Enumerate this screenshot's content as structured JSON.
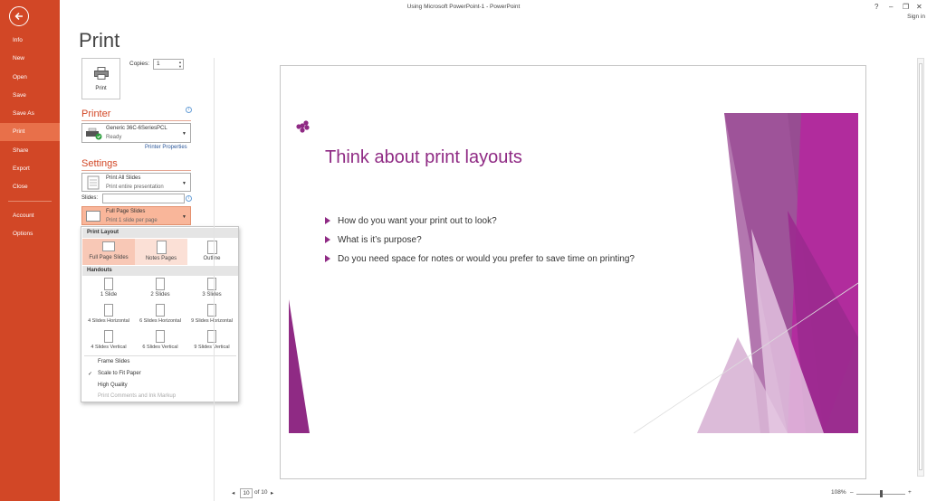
{
  "window": {
    "title": "Using Microsoft PowerPoint-1 - PowerPoint",
    "help": "?",
    "minimize": "–",
    "restore": "❐",
    "close": "✕",
    "sign_in": "Sign in"
  },
  "nav": {
    "items": [
      {
        "label": "Info"
      },
      {
        "label": "New"
      },
      {
        "label": "Open"
      },
      {
        "label": "Save"
      },
      {
        "label": "Save As"
      },
      {
        "label": "Print"
      },
      {
        "label": "Share"
      },
      {
        "label": "Export"
      },
      {
        "label": "Close"
      },
      {
        "label": "Account"
      },
      {
        "label": "Options"
      }
    ],
    "active": "Print"
  },
  "page_title": "Print",
  "print_button": {
    "label": "Print"
  },
  "copies": {
    "label": "Copies:",
    "value": "1"
  },
  "printer": {
    "heading": "Printer",
    "name": "Generic 36C-6SeriesPCL",
    "status": "Ready",
    "properties_link": "Printer Properties"
  },
  "settings": {
    "heading": "Settings",
    "range": {
      "title": "Print All Slides",
      "subtitle": "Print entire presentation"
    },
    "slides_label": "Slides:",
    "slides_value": "",
    "layout": {
      "title": "Full Page Slides",
      "subtitle": "Print 1 slide per page"
    }
  },
  "layout_popup": {
    "print_layout_header": "Print Layout",
    "print_layout": [
      {
        "label": "Full Page Slides",
        "state": "selected"
      },
      {
        "label": "Notes Pages",
        "state": "hover"
      },
      {
        "label": "Outline",
        "state": "normal"
      }
    ],
    "handouts_header": "Handouts",
    "handouts": [
      {
        "label": "1 Slide"
      },
      {
        "label": "2 Slides"
      },
      {
        "label": "3 Slides"
      },
      {
        "label": "4 Slides Horizontal"
      },
      {
        "label": "6 Slides Horizontal"
      },
      {
        "label": "9 Slides Horizontal"
      },
      {
        "label": "4 Slides Vertical"
      },
      {
        "label": "6 Slides Vertical"
      },
      {
        "label": "9 Slides Vertical"
      }
    ],
    "options": [
      {
        "label": "Frame Slides",
        "checked": false,
        "disabled": false
      },
      {
        "label": "Scale to Fit Paper",
        "checked": true,
        "disabled": false
      },
      {
        "label": "High Quality",
        "checked": false,
        "disabled": false
      },
      {
        "label": "Print Comments and Ink Markup",
        "checked": false,
        "disabled": true
      }
    ]
  },
  "preview": {
    "slide_title": "Think about print layouts",
    "bullets": [
      "How do you want your print out to look?",
      "What is it’s purpose?",
      "Do you need space for notes or would you prefer to save time on printing?"
    ],
    "accent_color": "#8f2a84"
  },
  "pager": {
    "prev": "◂",
    "current": "10",
    "of_total": "of 10",
    "next": "▸"
  },
  "zoom": {
    "level": "108%",
    "minus": "–",
    "plus": "+"
  }
}
